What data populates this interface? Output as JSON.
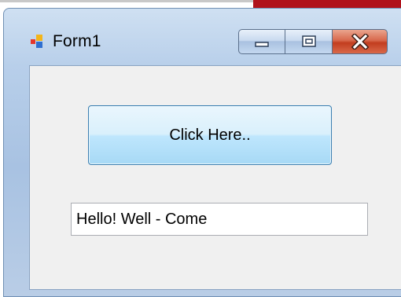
{
  "window": {
    "title": "Form1",
    "controls": {
      "minimize": "minimize",
      "maximize": "maximize",
      "close": "close"
    }
  },
  "form": {
    "button_label": "Click Here..",
    "textbox_value": "Hello! Well - Come"
  },
  "colors": {
    "close_button": "#c23d1f",
    "button_border": "#3c7fb1",
    "client_background": "#f0f0f0",
    "background_accent": "#b0121b"
  },
  "icons": [
    "app-icon",
    "minimize-icon",
    "maximize-icon",
    "close-icon"
  ]
}
